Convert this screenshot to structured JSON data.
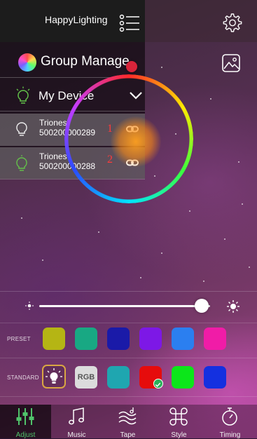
{
  "app": {
    "title": "HappyLighting"
  },
  "group": {
    "label": "Group Manage"
  },
  "device_header": {
    "label": "My Device"
  },
  "devices": [
    {
      "line1": "Triones-",
      "line2": "500200000289",
      "index": "1"
    },
    {
      "line1": "Triones-",
      "line2": "500200000288",
      "index": "2"
    }
  ],
  "brightness": {
    "level_percent": 95
  },
  "preset": {
    "label": "PRESET",
    "colors": [
      "#b5b514",
      "#18a883",
      "#1a1aa8",
      "#7d18e6",
      "#2b7ff0",
      "#f01ca7"
    ]
  },
  "standard": {
    "label": "STANDARD",
    "rgb_label": "RGB",
    "colors": [
      "#1fa6b0",
      "#e60c0c",
      "#0ce61a",
      "#1430e0"
    ],
    "selected": "#e60c0c"
  },
  "nav": {
    "tabs": [
      {
        "label": "Adjust",
        "icon": "sliders-icon",
        "active": true
      },
      {
        "label": "Music",
        "icon": "music-note-icon"
      },
      {
        "label": "Tape",
        "icon": "tape-wave-icon"
      },
      {
        "label": "Style",
        "icon": "command-icon"
      },
      {
        "label": "Timing",
        "icon": "timer-icon"
      }
    ]
  }
}
